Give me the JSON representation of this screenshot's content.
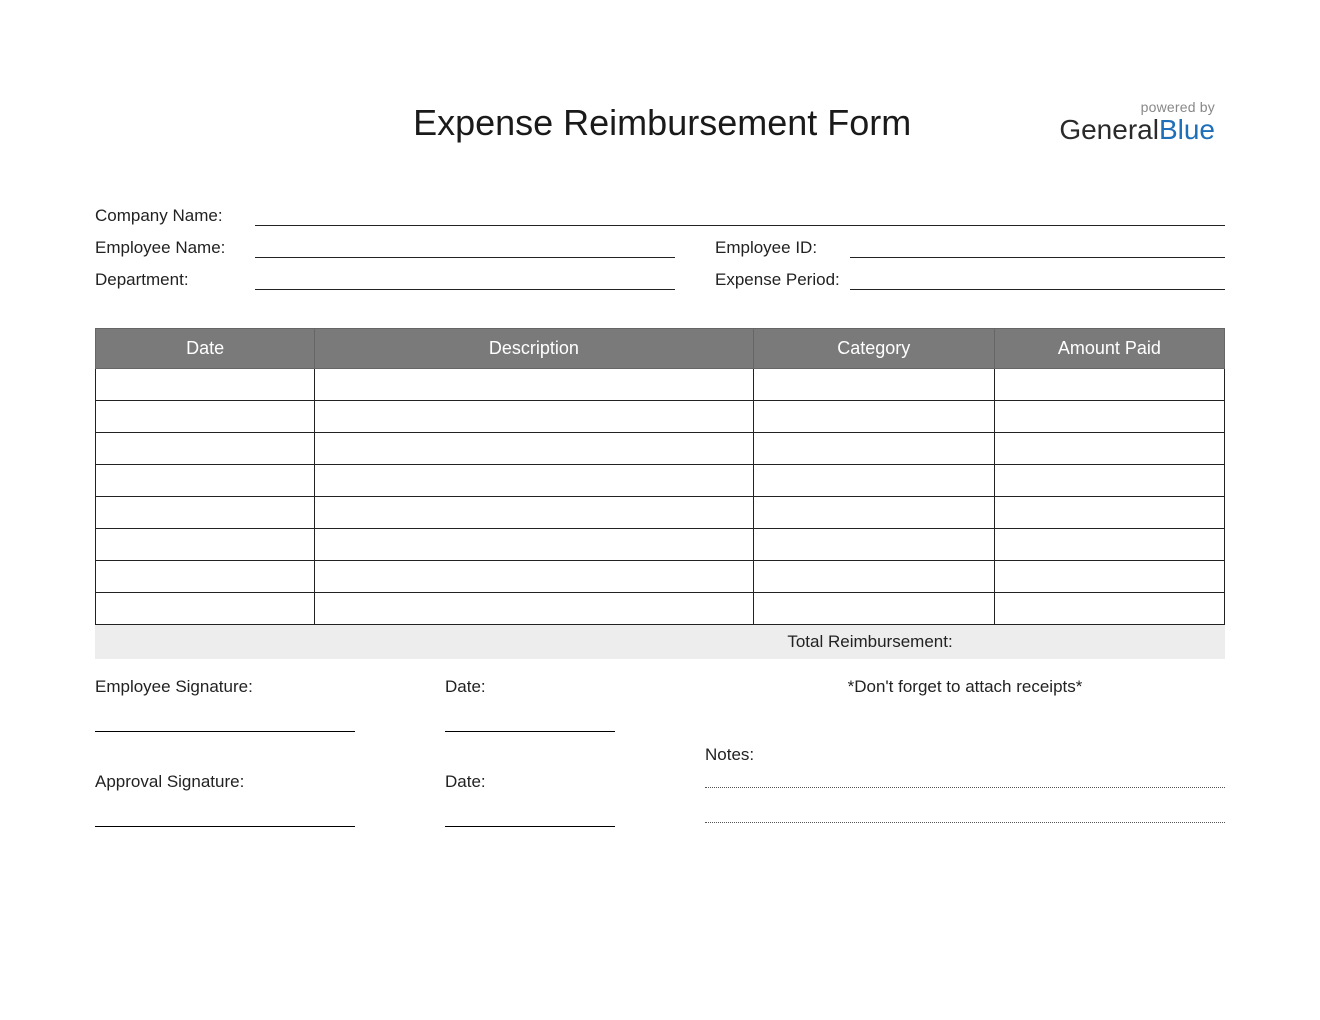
{
  "header": {
    "title": "Expense Reimbursement Form",
    "powered_by": "powered by",
    "brand_general": "General",
    "brand_blue": "Blue"
  },
  "info": {
    "company_name_label": "Company Name:",
    "employee_name_label": "Employee Name:",
    "employee_id_label": "Employee ID:",
    "department_label": "Department:",
    "expense_period_label": "Expense Period:"
  },
  "table": {
    "headers": {
      "date": "Date",
      "description": "Description",
      "category": "Category",
      "amount_paid": "Amount Paid"
    },
    "row_count": 8,
    "total_label": "Total Reimbursement:"
  },
  "footer": {
    "employee_signature_label": "Employee Signature:",
    "approval_signature_label": "Approval Signature:",
    "date_label": "Date:",
    "reminder": "*Don't forget to attach receipts*",
    "notes_label": "Notes:"
  }
}
